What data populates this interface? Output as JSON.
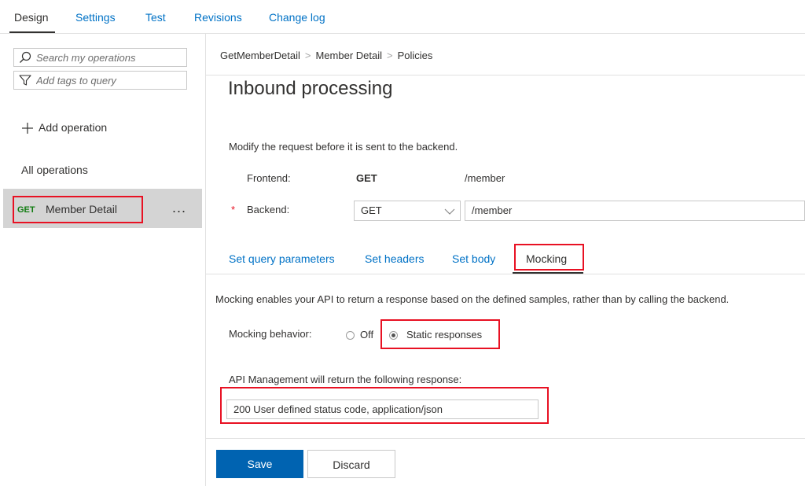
{
  "top_tabs": [
    {
      "label": "Design",
      "active": true
    },
    {
      "label": "Settings"
    },
    {
      "label": "Test"
    },
    {
      "label": "Revisions"
    },
    {
      "label": "Change log"
    }
  ],
  "sidebar": {
    "search_placeholder": "Search my operations",
    "tags_placeholder": "Add tags to query",
    "add_operation": "Add operation",
    "all_operations": "All operations",
    "operation": {
      "method": "GET",
      "name": "Member Detail",
      "more": "..."
    }
  },
  "breadcrumb": [
    "GetMemberDetail",
    "Member Detail",
    "Policies"
  ],
  "breadcrumb_sep": ">",
  "title": "Inbound processing",
  "description": "Modify the request before it is sent to the backend.",
  "frontend": {
    "label": "Frontend:",
    "method": "GET",
    "path": "/member"
  },
  "backend": {
    "required_mark": "*",
    "label": "Backend:",
    "method": "GET",
    "path": "/member"
  },
  "sub_tabs": [
    {
      "label": "Set query parameters"
    },
    {
      "label": "Set headers"
    },
    {
      "label": "Set body"
    },
    {
      "label": "Mocking",
      "active": true
    }
  ],
  "mocking": {
    "description": "Mocking enables your API to return a response based on the defined samples, rather than by calling the backend.",
    "behavior_label": "Mocking behavior:",
    "options": [
      "Off",
      "Static responses"
    ],
    "selected": "Static responses",
    "response_label": "API Management will return the following response:",
    "response_value": "200 User defined status code, application/json"
  },
  "buttons": {
    "save": "Save",
    "discard": "Discard"
  },
  "colors": {
    "link": "#0072c6",
    "primary": "#0063b1",
    "highlight": "#e81123",
    "get": "#107c10"
  }
}
